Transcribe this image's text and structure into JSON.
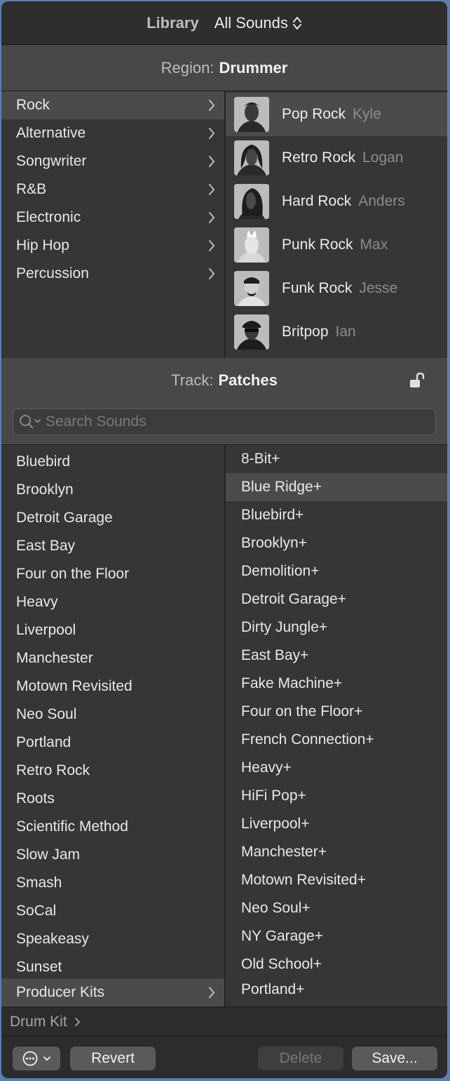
{
  "library": {
    "label": "Library",
    "value": "All Sounds"
  },
  "region": {
    "label": "Region:",
    "value": "Drummer"
  },
  "genres": [
    {
      "label": "Rock",
      "selected": true
    },
    {
      "label": "Alternative"
    },
    {
      "label": "Songwriter"
    },
    {
      "label": "R&B"
    },
    {
      "label": "Electronic"
    },
    {
      "label": "Hip Hop"
    },
    {
      "label": "Percussion"
    }
  ],
  "drummers": [
    {
      "style": "Pop Rock",
      "name": "Kyle",
      "selected": true
    },
    {
      "style": "Retro Rock",
      "name": "Logan"
    },
    {
      "style": "Hard Rock",
      "name": "Anders"
    },
    {
      "style": "Punk Rock",
      "name": "Max"
    },
    {
      "style": "Funk Rock",
      "name": "Jesse"
    },
    {
      "style": "Britpop",
      "name": "Ian"
    }
  ],
  "track": {
    "label": "Track:",
    "value": "Patches"
  },
  "search": {
    "placeholder": "Search Sounds"
  },
  "patches": [
    "Bluebird",
    "Brooklyn",
    "Detroit Garage",
    "East Bay",
    "Four on the Floor",
    "Heavy",
    "Liverpool",
    "Manchester",
    "Motown Revisited",
    "Neo Soul",
    "Portland",
    "Retro Rock",
    "Roots",
    "Scientific Method",
    "Slow Jam",
    "Smash",
    "SoCal",
    "Speakeasy",
    "Sunset",
    "Producer Kits"
  ],
  "kits": [
    "8-Bit+",
    "Blue Ridge+",
    "Bluebird+",
    "Brooklyn+",
    "Demolition+",
    "Detroit Garage+",
    "Dirty Jungle+",
    "East Bay+",
    "Fake Machine+",
    "Four on the Floor+",
    "French Connection+",
    "Heavy+",
    "HiFi Pop+",
    "Liverpool+",
    "Manchester+",
    "Motown Revisited+",
    "Neo Soul+",
    "NY Garage+",
    "Old School+",
    "Portland+"
  ],
  "breadcrumb": {
    "label": "Drum Kit"
  },
  "footer": {
    "revert": "Revert",
    "delete": "Delete",
    "save": "Save..."
  }
}
